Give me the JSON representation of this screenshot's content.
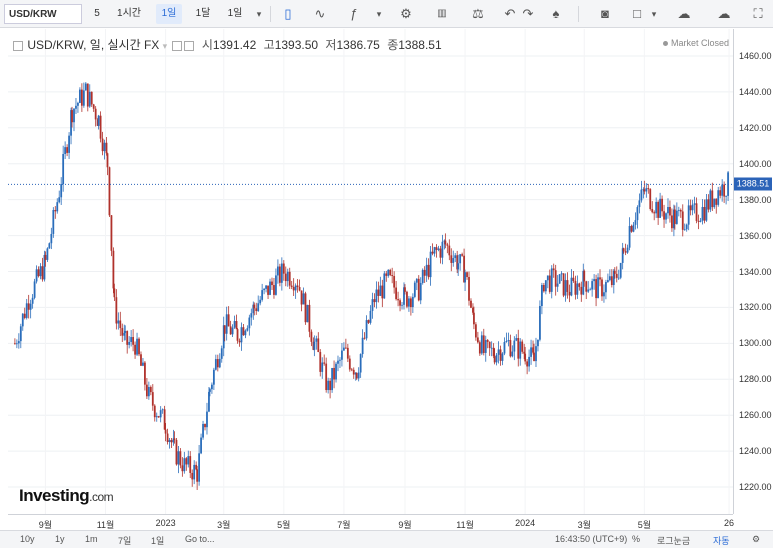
{
  "toolbar": {
    "symbol": "USD/KRW",
    "resolutions": [
      "5",
      "1시간",
      "1일",
      "1달",
      "1일"
    ],
    "active_resolution": "1일",
    "icons": [
      "candlestick-icon",
      "line-chart-icon",
      "indicator-icon",
      "settings-icon",
      "compare-icon",
      "balance-icon",
      "undo-icon",
      "redo-icon",
      "alert-icon",
      "camera-icon",
      "color-box-icon",
      "cloud-download-icon",
      "cloud-upload-icon",
      "fullscreen-icon"
    ]
  },
  "legend": {
    "title": "USD/KRW, 일, 실시간 FX",
    "open_label": "시",
    "open": "1391.42",
    "high_label": "고",
    "high": "1393.50",
    "low_label": "저",
    "low": "1386.75",
    "close_label": "종",
    "close": "1388.51",
    "status": "Market Closed"
  },
  "last_price_tag": "1388.51",
  "branding": {
    "name": "Investing",
    "suffix": ".com"
  },
  "bottom_bar": {
    "ranges": [
      "10y",
      "1y",
      "1m",
      "7일",
      "1일",
      "Go to..."
    ],
    "time": "16:43:50 (UTC+9)",
    "percent": "%",
    "log": "로그눈금",
    "auto": "자동"
  },
  "colors": {
    "up": "#2a6dbb",
    "down": "#b0312b",
    "price_line": "#2b63b8"
  },
  "chart_data": {
    "type": "line",
    "title": "USD/KRW, 일, 실시간 FX",
    "xlabel": "",
    "ylabel": "",
    "x_tick_labels": [
      "9월",
      "11월",
      "2023",
      "3월",
      "5월",
      "7월",
      "9월",
      "11월",
      "2024",
      "3월",
      "5월",
      "26"
    ],
    "y_ticks": [
      1220,
      1240,
      1260,
      1280,
      1300,
      1320,
      1340,
      1360,
      1380,
      1400,
      1420,
      1440,
      1460
    ],
    "ylim": [
      1205,
      1475
    ],
    "last_price": 1388.51,
    "grid": true,
    "series": [
      {
        "x": [
          "2022-08-01",
          "2022-08-15",
          "2022-09-01",
          "2022-09-15",
          "2022-09-28",
          "2022-10-12",
          "2022-10-25",
          "2022-11-03",
          "2022-11-10",
          "2022-11-21",
          "2022-12-01",
          "2022-12-15",
          "2023-01-01",
          "2023-01-10",
          "2023-01-20",
          "2023-02-02",
          "2023-02-15",
          "2023-03-02",
          "2023-03-15",
          "2023-04-01",
          "2023-04-15",
          "2023-05-01",
          "2023-05-15",
          "2023-06-01",
          "2023-06-15",
          "2023-07-01",
          "2023-07-14",
          "2023-08-01",
          "2023-08-15",
          "2023-09-01",
          "2023-09-15",
          "2023-10-01",
          "2023-10-12",
          "2023-10-25",
          "2023-11-01",
          "2023-11-10",
          "2023-11-20",
          "2023-12-01",
          "2023-12-15",
          "2024-01-01",
          "2024-01-10",
          "2024-01-20",
          "2024-02-01",
          "2024-02-15",
          "2024-03-01",
          "2024-03-15",
          "2024-04-01",
          "2024-04-10",
          "2024-04-16",
          "2024-05-01",
          "2024-05-15",
          "2024-06-01",
          "2024-06-15",
          "2024-07-01",
          "2024-07-15",
          "2024-07-26"
        ],
        "values": [
          1300,
          1325,
          1345,
          1385,
          1430,
          1440,
          1425,
          1400,
          1320,
          1300,
          1300,
          1270,
          1255,
          1240,
          1232,
          1228,
          1275,
          1310,
          1305,
          1320,
          1330,
          1340,
          1335,
          1300,
          1275,
          1295,
          1285,
          1325,
          1335,
          1325,
          1330,
          1350,
          1355,
          1345,
          1340,
          1310,
          1295,
          1295,
          1300,
          1295,
          1290,
          1335,
          1335,
          1330,
          1335,
          1330,
          1335,
          1350,
          1365,
          1385,
          1375,
          1370,
          1370,
          1375,
          1385,
          1389
        ]
      }
    ]
  }
}
